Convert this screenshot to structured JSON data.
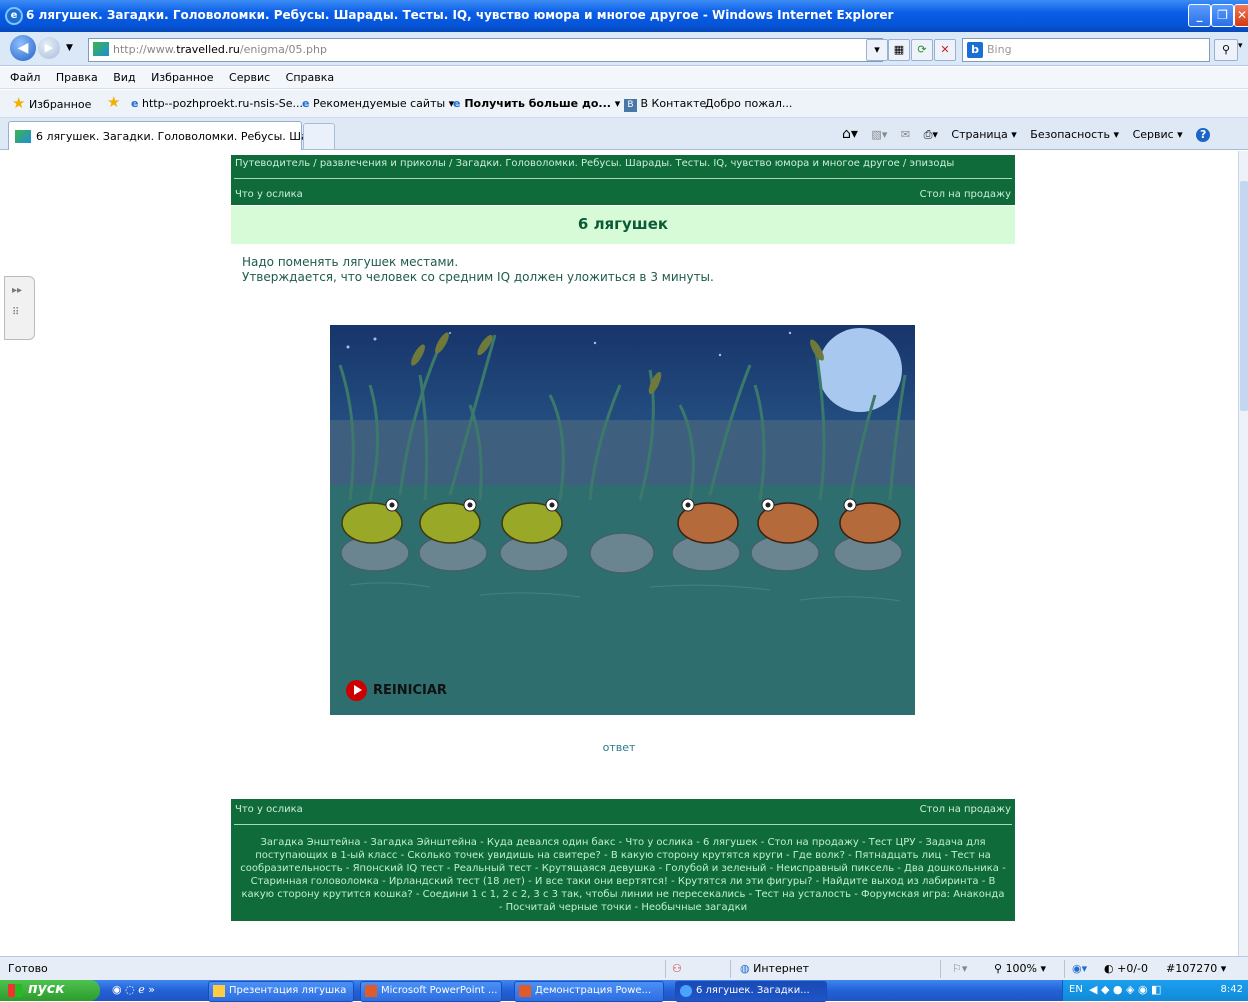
{
  "window": {
    "title": "6 лягушек. Загадки. Головоломки. Ребусы. Шарады. Тесты. IQ, чувство юмора и многое другое - Windows Internet Explorer"
  },
  "nav": {
    "url_prefix": "http://www.",
    "url_domain": "travelled.ru",
    "url_path": "/enigma/05.php",
    "search_placeholder": "Bing"
  },
  "menu": [
    "Файл",
    "Правка",
    "Вид",
    "Избранное",
    "Сервис",
    "Справка"
  ],
  "favorites": {
    "label": "Избранное",
    "items": [
      "http--pozhproekt.ru-nsis-Se...",
      "Рекомендуемые сайты ▾",
      "Получить больше до... ▾",
      "В Контакте",
      "Добро пожал..."
    ]
  },
  "tab": {
    "label": "6 лягушек. Загадки. Головоломки. Ребусы. Шара..."
  },
  "command_bar": [
    "Страница ▾",
    "Безопасность ▾",
    "Сервис ▾"
  ],
  "page": {
    "breadcrumb": "Путеводитель / развлечения и приколы / Загадки. Головоломки. Ребусы. Шарады. Тесты. IQ, чувство юмора и многое другое / эпизоды",
    "prev_link": "Что у ослика",
    "next_link": "Стол на продажу",
    "heading": "6 лягушек",
    "desc_line1": "Надо поменять лягушек местами.",
    "desc_line2": "Утверждается, что человек со средним IQ должен уложиться в 3 минуты.",
    "game_button": "REINICIAR",
    "answer_link": "ответ",
    "footer_prev": "Что у ослика",
    "footer_next": "Стол на продажу",
    "links": "Загадка Энштейна - Загадка Эйнштейна - Куда девался один бакс - Что у ослика - 6 лягушек - Стол на продажу - Тест ЦРУ - Задача для поступающих в 1-ый класс - Сколько точек увидишь на свитере? - В какую сторону крутятся круги - Где волк? - Пятнадцать лиц - Тест на сообразительность - Японский IQ тест - Реальный тест - Крутящаяся девушка - Голубой и зеленый - Неисправный пиксель - Два дошкольника - Старинная головоломка - Ирландский тест (18 лет) - И все таки они вертятся! - Крутятся ли эти фигуры? - Найдите выход из лабиринта - В какую сторону крутится кошка? - Соедини 1 с 1, 2 с 2, 3 с 3 так, чтобы линии не пересекались - Тест на усталость - Форумская игра: Анаконда - Посчитай черные точки - Необычные загадки"
  },
  "status": {
    "left": "Готово",
    "zone": "Интернет",
    "zoom": "100%",
    "counter": "+0/-0",
    "id": "#107270 ▾"
  },
  "taskbar": {
    "start": "пуск",
    "tasks": [
      "Презентация лягушка",
      "Microsoft PowerPoint ...",
      "Демонстрация Powe...",
      "6 лягушек. Загадки..."
    ],
    "lang": "EN",
    "time": "8:42"
  },
  "colors": {
    "page_green": "#0f6b3a",
    "title_bg": "#d7fbd7",
    "pond_water": "#2e6a6e"
  }
}
